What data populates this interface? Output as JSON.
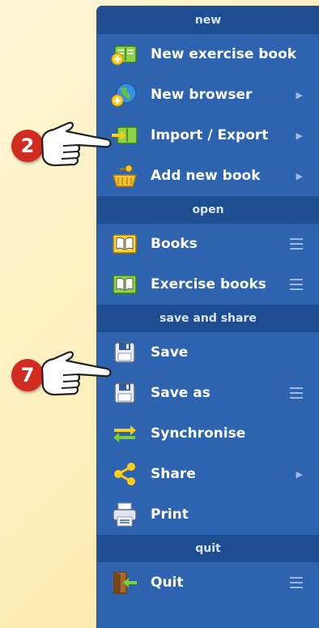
{
  "menu": {
    "sections": [
      {
        "title": "new"
      },
      {
        "title": "open"
      },
      {
        "title": "save and share"
      },
      {
        "title": "quit"
      }
    ],
    "items": [
      {
        "label": "New exercise book",
        "icon": "exercise-book-add-icon",
        "indicator": "none"
      },
      {
        "label": "New browser",
        "icon": "globe-add-icon",
        "indicator": "submenu-arrow"
      },
      {
        "label": "Import / Export",
        "icon": "import-export-icon",
        "indicator": "submenu-arrow"
      },
      {
        "label": "Add new book",
        "icon": "book-basket-add-icon",
        "indicator": "submenu-arrow"
      },
      {
        "label": "Books",
        "icon": "book-icon",
        "indicator": "menu-lines"
      },
      {
        "label": "Exercise books",
        "icon": "exercise-book-icon",
        "indicator": "menu-lines"
      },
      {
        "label": "Save",
        "icon": "floppy-disk-icon",
        "indicator": "none"
      },
      {
        "label": "Save as",
        "icon": "floppy-disk-as-icon",
        "indicator": "menu-lines"
      },
      {
        "label": "Synchronise",
        "icon": "sync-arrows-icon",
        "indicator": "none"
      },
      {
        "label": "Share",
        "icon": "share-icon",
        "indicator": "submenu-arrow"
      },
      {
        "label": "Print",
        "icon": "printer-icon",
        "indicator": "none"
      },
      {
        "label": "Quit",
        "icon": "exit-door-icon",
        "indicator": "menu-lines"
      }
    ]
  },
  "callouts": [
    {
      "number": "2",
      "points_to": "Import / Export"
    },
    {
      "number": "7",
      "points_to": "Save"
    }
  ],
  "colors": {
    "menu_background": "#2e63b0",
    "section_header": "#1e4d91",
    "page_background": "#fdeeb8",
    "badge": "#d12c1f"
  }
}
